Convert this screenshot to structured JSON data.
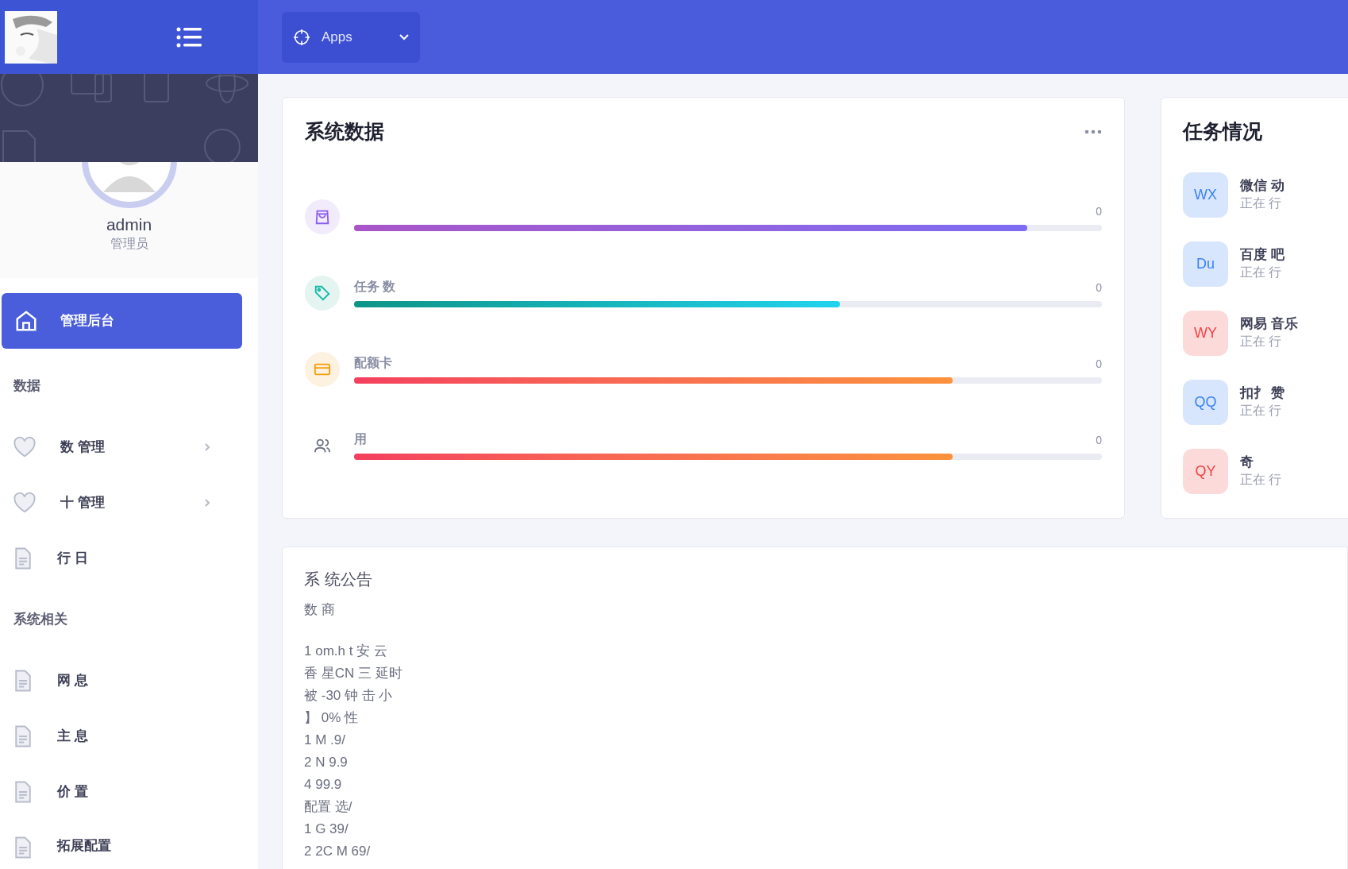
{
  "topbar": {
    "apps_button": "Apps"
  },
  "sidebar": {
    "user_name": "admin",
    "user_role": "管理员",
    "items": [
      {
        "kind": "link",
        "label": "管理后台",
        "selected": true,
        "submenu": false
      },
      {
        "kind": "section",
        "label": "数据"
      },
      {
        "kind": "link",
        "label": "数 管理",
        "selected": false,
        "submenu": true
      },
      {
        "kind": "link",
        "label": "十 管理",
        "selected": false,
        "submenu": true
      },
      {
        "kind": "link",
        "label": "行 日",
        "selected": false,
        "submenu": false
      },
      {
        "kind": "section",
        "label": "系统相关"
      },
      {
        "kind": "link",
        "label": "网 息",
        "selected": false,
        "submenu": false
      },
      {
        "kind": "link",
        "label": "主 息",
        "selected": false,
        "submenu": false
      },
      {
        "kind": "link",
        "label": "价 置",
        "selected": false,
        "submenu": false
      },
      {
        "kind": "link",
        "label": "拓展配置",
        "selected": false,
        "submenu": false
      }
    ]
  },
  "stats_card": {
    "title": "系统数据",
    "rows": [
      {
        "value": "0",
        "level": 0.9
      },
      {
        "label": "任务 数",
        "value": "0",
        "level": 0.65
      },
      {
        "label": "配额卡",
        "value": "0",
        "level": 0.8
      },
      {
        "label": "用",
        "value": "0",
        "level": 0.8
      }
    ]
  },
  "tasks_card": {
    "title": "任务情况",
    "tasks": [
      {
        "badge": "WX",
        "color": "#3b82f6",
        "name": "微信 动",
        "status": "正在 行"
      },
      {
        "badge": "Du",
        "color": "#3b82f6",
        "name": "百度 吧",
        "status": "正在 行"
      },
      {
        "badge": "WY",
        "color": "#ef4444",
        "name": "网易 音乐",
        "status": "正在 行"
      },
      {
        "badge": "QQ",
        "color": "#3b82f6",
        "name": "扣扌 赞",
        "status": "正在 行"
      },
      {
        "badge": "QY",
        "color": "#ef4444",
        "name": "奇",
        "status": "正在 行"
      }
    ]
  },
  "notice_card": {
    "title": "系 统公告",
    "lines": [
      "数 商",
      "1 om.h t 安 云",
      "香 星CN 三 延时",
      "被 -30 钟 击 小",
      "】 0% 性",
      "1 M .9/",
      "2 N 9.9",
      "4 99.9",
      "配置 选/",
      "1 G 39/",
      "2 2C M 69/"
    ]
  }
}
